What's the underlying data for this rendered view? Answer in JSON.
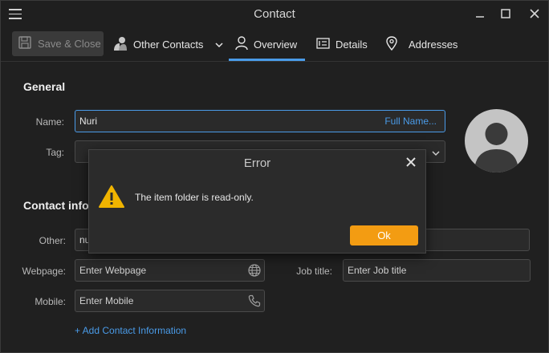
{
  "window": {
    "title": "Contact"
  },
  "toolbar": {
    "save_close_label": "Save & Close",
    "other_contacts_label": "Other Contacts",
    "tabs": [
      {
        "label": "Overview",
        "active": true
      },
      {
        "label": "Details",
        "active": false
      },
      {
        "label": "Addresses",
        "active": false
      }
    ]
  },
  "general": {
    "title": "General",
    "name_label": "Name:",
    "name_value": "Nuri",
    "full_name_link": "Full Name...",
    "tag_label": "Tag:"
  },
  "contact_info": {
    "title": "Contact infor",
    "other_label": "Other:",
    "other_value": "nu",
    "webpage_label": "Webpage:",
    "webpage_placeholder": "Enter Webpage",
    "job_title_label": "Job title:",
    "job_title_placeholder": "Enter Job title",
    "mobile_label": "Mobile:",
    "mobile_placeholder": "Enter Mobile",
    "add_link": "+ Add Contact Information"
  },
  "dialog": {
    "title": "Error",
    "message": "The item folder is read-only.",
    "ok_label": "Ok"
  },
  "colors": {
    "accent": "#4a9be8",
    "ok_button": "#f39c12",
    "warning": "#f0b400",
    "background": "#202020"
  },
  "icons": [
    "menu-icon",
    "minimize-icon",
    "maximize-icon",
    "close-icon",
    "save-icon",
    "contacts-icon",
    "chevron-down-icon",
    "person-icon",
    "details-icon",
    "location-pin-icon",
    "globe-icon",
    "phone-icon",
    "warning-icon",
    "avatar-icon"
  ]
}
